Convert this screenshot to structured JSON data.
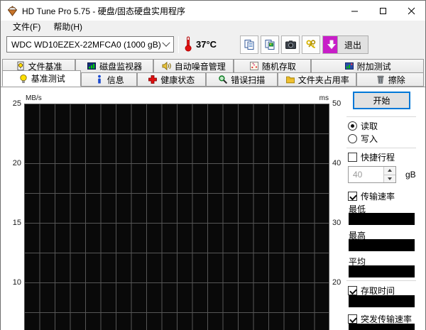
{
  "window": {
    "title": "HD Tune Pro 5.75 - 硬盘/固态硬盘实用程序",
    "controls": {
      "minimize": "minimize",
      "maximize": "maximize",
      "close": "close"
    }
  },
  "menu": {
    "file": "文件(F)",
    "help": "帮助(H)"
  },
  "toolbar": {
    "drive_select": "WDC WD10EZEX-22MFCA0 (1000 gB)",
    "temperature": "37°C",
    "exit_label": "退出",
    "icon_buttons": [
      "copy-text",
      "copy-image",
      "screenshot",
      "keys",
      "download"
    ]
  },
  "tabs": {
    "row1": [
      {
        "label": "文件基准"
      },
      {
        "label": "磁盘监视器"
      },
      {
        "label": "自动噪音管理"
      },
      {
        "label": "随机存取"
      },
      {
        "label": "附加测试"
      }
    ],
    "row2": [
      {
        "label": "基准测试",
        "active": true
      },
      {
        "label": "信息",
        "active": false
      },
      {
        "label": "健康状态",
        "active": false
      },
      {
        "label": "错误扫描",
        "active": false
      },
      {
        "label": "文件夹占用率",
        "active": false
      },
      {
        "label": "擦除",
        "active": false
      }
    ]
  },
  "chart_data": {
    "type": "line",
    "title": "",
    "series": [],
    "grid": true,
    "background": "#090909",
    "gridline_color": "#565656",
    "left_axis": {
      "label": "MB/s",
      "ticks": [
        25,
        20,
        15,
        10
      ]
    },
    "right_axis": {
      "label": "ms",
      "ticks": [
        50,
        40,
        30,
        20
      ]
    }
  },
  "panel": {
    "start_button": "开始",
    "mode": {
      "read_label": "读取",
      "read_selected": true,
      "write_label": "写入",
      "write_selected": false
    },
    "short_stroke": {
      "label": "快捷行程",
      "checked": false,
      "value": "40",
      "unit": "gB"
    },
    "transfer_rate": {
      "label": "传输速率",
      "checked": true
    },
    "stats": [
      {
        "label": "最低",
        "value": ""
      },
      {
        "label": "最高",
        "value": ""
      },
      {
        "label": "平均",
        "value": ""
      }
    ],
    "access_time": {
      "label": "存取时间",
      "checked": true,
      "value": ""
    },
    "burst_rate": {
      "label": "突发传输速率",
      "checked": true,
      "value": ""
    }
  },
  "colors": {
    "accent_blue": "#0078d7",
    "download_button": "#c81ec8",
    "value_box": "#000000"
  }
}
